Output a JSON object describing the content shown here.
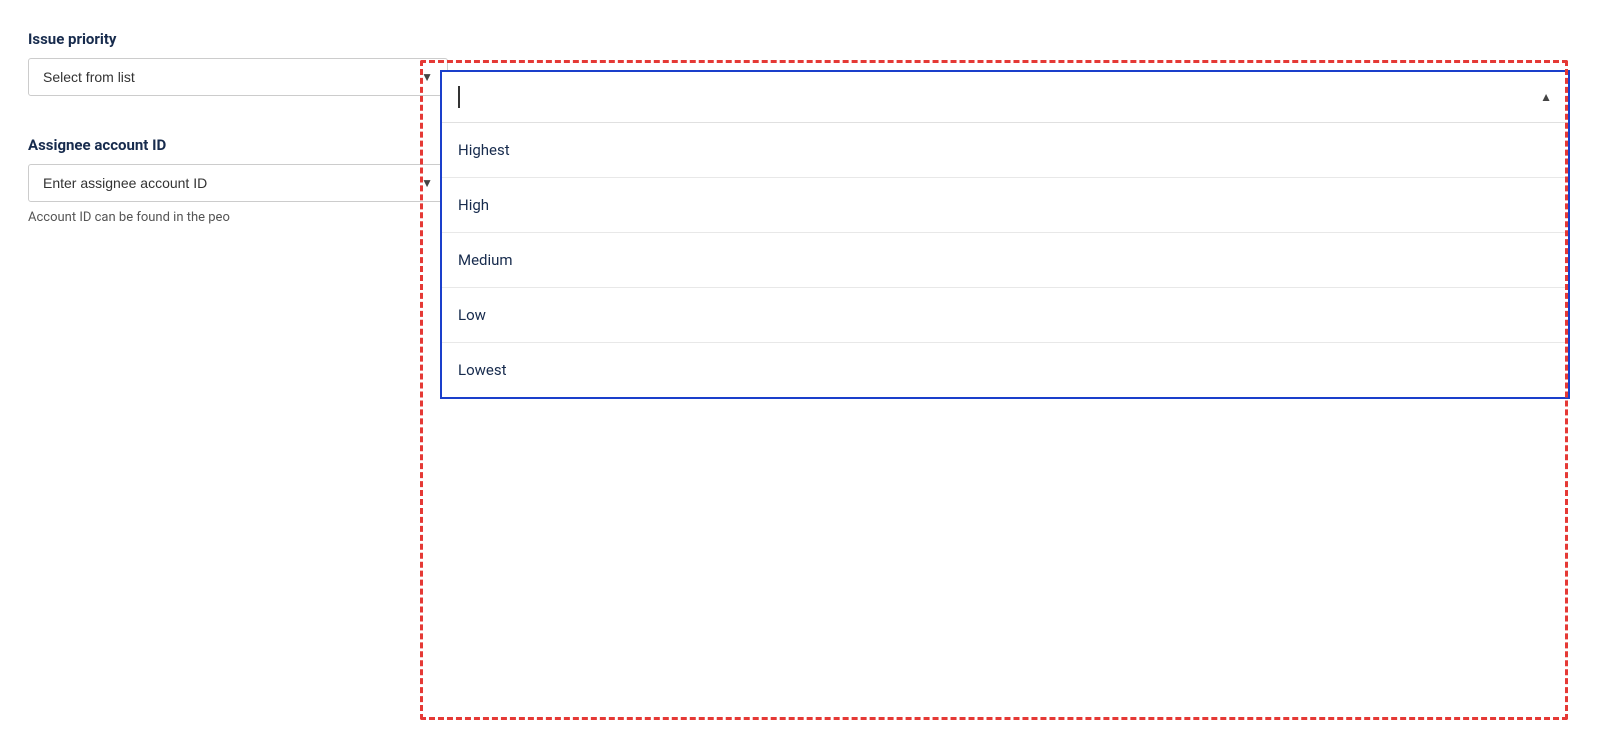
{
  "left_panel": {
    "issue_priority_label": "Issue priority",
    "select_placeholder": "Select from list",
    "assignee_label": "Assignee account ID",
    "assignee_placeholder": "Enter assignee account ID",
    "assignee_hint": "Account ID can be found in the peo"
  },
  "dropdown": {
    "search_placeholder": "",
    "up_arrow": "▲",
    "options": [
      {
        "value": "Highest"
      },
      {
        "value": "High"
      },
      {
        "value": "Medium"
      },
      {
        "value": "Low"
      },
      {
        "value": "Lowest"
      }
    ]
  },
  "icons": {
    "chevron_down": "▼",
    "chevron_up": "▲"
  }
}
